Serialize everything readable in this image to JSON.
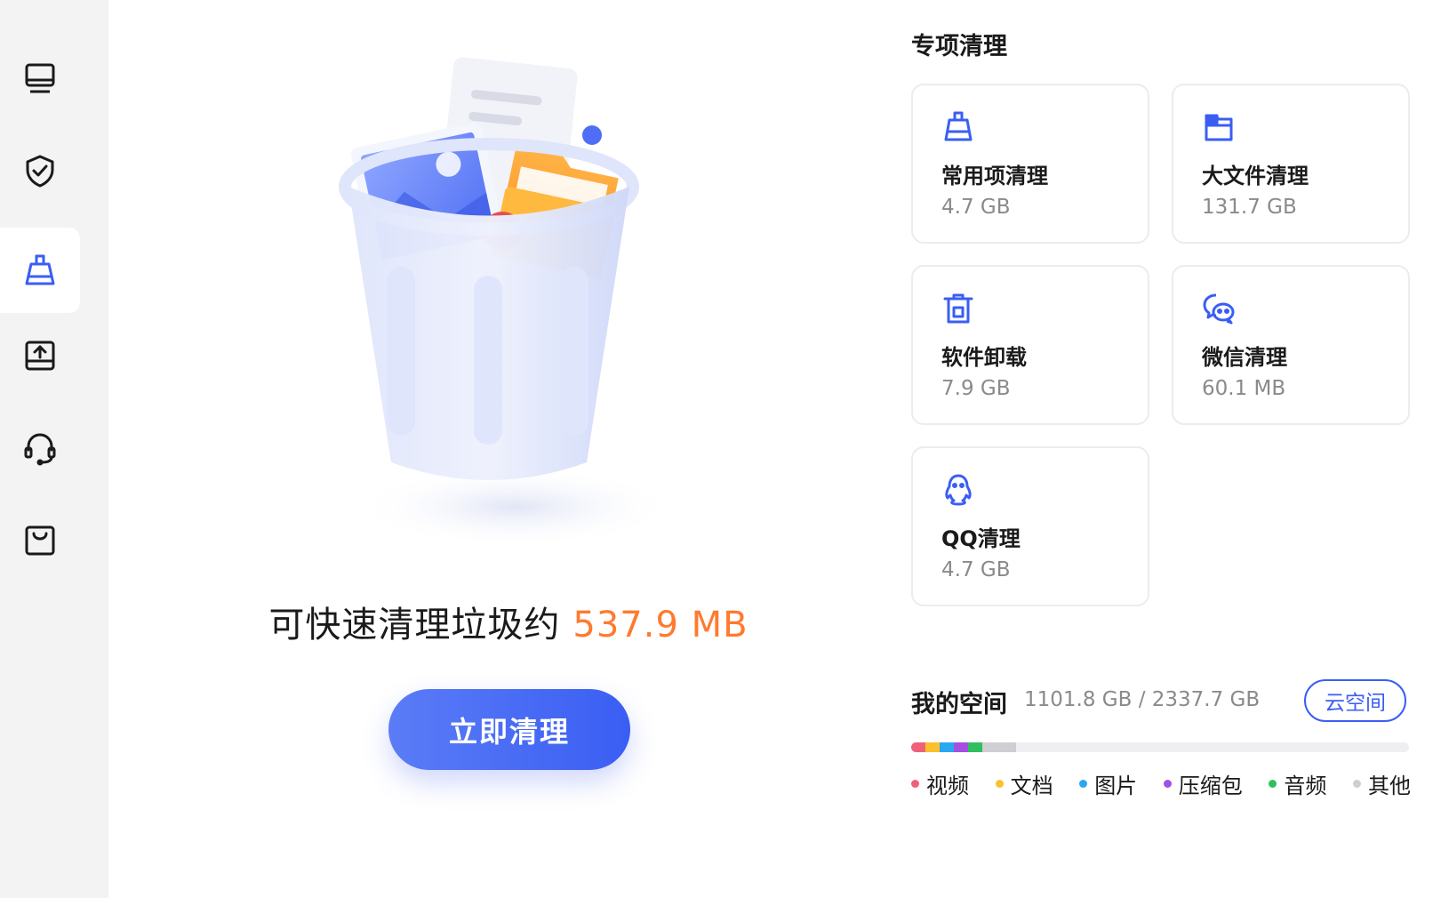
{
  "sidebar": {
    "items": [
      {
        "icon": "monitor-icon"
      },
      {
        "icon": "shield-check-icon"
      },
      {
        "icon": "cleanup-brush-icon"
      },
      {
        "icon": "drive-upload-icon"
      },
      {
        "icon": "headset-icon"
      },
      {
        "icon": "shopping-bag-icon"
      }
    ],
    "active_index": 2
  },
  "main": {
    "summary_text": "可快速清理垃圾约",
    "summary_size": "537.9 MB",
    "clean_button": "立即清理"
  },
  "special": {
    "title": "专项清理",
    "cards": [
      {
        "icon": "broom-icon",
        "label": "常用项清理",
        "value": "4.7 GB"
      },
      {
        "icon": "folder-icon",
        "label": "大文件清理",
        "value": "131.7 GB"
      },
      {
        "icon": "uninstall-bin-icon",
        "label": "软件卸载",
        "value": "7.9 GB"
      },
      {
        "icon": "wechat-icon",
        "label": "微信清理",
        "value": "60.1 MB"
      },
      {
        "icon": "qq-icon",
        "label": "QQ清理",
        "value": "4.7 GB"
      }
    ]
  },
  "space": {
    "title": "我的空间",
    "value": "1101.8 GB / 2337.7 GB",
    "cloud_button": "云空间",
    "legend": [
      {
        "label": "视频",
        "color": "#f1607a"
      },
      {
        "label": "文档",
        "color": "#fbc02d"
      },
      {
        "label": "图片",
        "color": "#29a7f0"
      },
      {
        "label": "压缩包",
        "color": "#a34fe0"
      },
      {
        "label": "音频",
        "color": "#2fbf5f"
      },
      {
        "label": "其他",
        "color": "#cfcfd3"
      }
    ]
  },
  "colors": {
    "accent": "#3a5ef4",
    "highlight": "#ff7a2f",
    "sidebar_bg": "#f3f3f4"
  }
}
